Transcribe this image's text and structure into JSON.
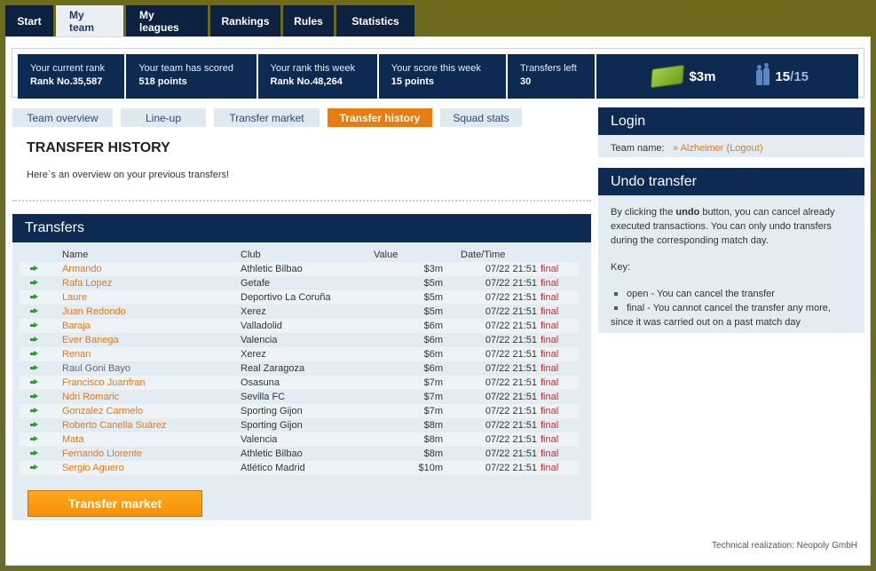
{
  "nav": {
    "tabs": [
      {
        "label": "Start"
      },
      {
        "label": "My team",
        "active": true
      },
      {
        "label": "My leagues"
      },
      {
        "label": "Rankings"
      },
      {
        "label": "Rules"
      },
      {
        "label": "Statistics"
      }
    ]
  },
  "stats": {
    "current_rank_label": "Your current rank",
    "current_rank_value": "Rank No.35,587",
    "scored_label": "Your team has scored",
    "scored_value": "518 points",
    "week_rank_label": "Your rank this week",
    "week_rank_value": "Rank No.48,264",
    "week_score_label": "Your score this week",
    "week_score_value": "15 points",
    "transfers_left_label": "Transfers left",
    "transfers_left_value": "30",
    "budget": "$3m",
    "squad_count": "15",
    "squad_total": "/15",
    "money_icon": "money-stack-icon",
    "squad_icon": "people-icon"
  },
  "subtabs": [
    {
      "label": "Team overview"
    },
    {
      "label": "Line-up"
    },
    {
      "label": "Transfer market"
    },
    {
      "label": "Transfer history",
      "active": true
    },
    {
      "label": "Squad stats"
    }
  ],
  "main": {
    "title": "TRANSFER HISTORY",
    "intro": "Here`s an overview on your previous transfers!"
  },
  "transfers": {
    "heading": "Transfers",
    "columns": {
      "name": "Name",
      "club": "Club",
      "value": "Value",
      "date": "Date/Time"
    },
    "rows": [
      {
        "name": "Armando",
        "club": "Athletic Bilbao",
        "value": "$3m",
        "date": "07/22 21:51",
        "status": "final"
      },
      {
        "name": "Rafa Lopez",
        "club": "Getafe",
        "value": "$5m",
        "date": "07/22 21:51",
        "status": "final"
      },
      {
        "name": "Laure",
        "club": "Deportivo La Coruña",
        "value": "$5m",
        "date": "07/22 21:51",
        "status": "final"
      },
      {
        "name": "Juan Redondo",
        "club": "Xerez",
        "value": "$5m",
        "date": "07/22 21:51",
        "status": "final"
      },
      {
        "name": "Baraja",
        "club": "Valladolid",
        "value": "$6m",
        "date": "07/22 21:51",
        "status": "final"
      },
      {
        "name": "Ever Banega",
        "club": "Valencia",
        "value": "$6m",
        "date": "07/22 21:51",
        "status": "final"
      },
      {
        "name": "Renan",
        "club": "Xerez",
        "value": "$6m",
        "date": "07/22 21:51",
        "status": "final"
      },
      {
        "name": "Raul Goni Bayo",
        "club": "Real Zaragoza",
        "value": "$6m",
        "date": "07/22 21:51",
        "status": "final"
      },
      {
        "name": "Francisco Juanfran",
        "club": "Osasuna",
        "value": "$7m",
        "date": "07/22 21:51",
        "status": "final"
      },
      {
        "name": "Ndri Romaric",
        "club": "Sevilla FC",
        "value": "$7m",
        "date": "07/22 21:51",
        "status": "final"
      },
      {
        "name": "Gonzalez Carmelo",
        "club": "Sporting Gijon",
        "value": "$7m",
        "date": "07/22 21:51",
        "status": "final"
      },
      {
        "name": "Roberto Canella Suárez",
        "club": "Sporting Gijon",
        "value": "$8m",
        "date": "07/22 21:51",
        "status": "final"
      },
      {
        "name": "Mata",
        "club": "Valencia",
        "value": "$8m",
        "date": "07/22 21:51",
        "status": "final"
      },
      {
        "name": "Fernando Llorente",
        "club": "Athletic Bilbao",
        "value": "$8m",
        "date": "07/22 21:51",
        "status": "final"
      },
      {
        "name": "Sergio Aguero",
        "club": "Atlético Madrid",
        "value": "$10m",
        "date": "07/22 21:51",
        "status": "final"
      }
    ],
    "button_label": "Transfer market"
  },
  "login": {
    "heading": "Login",
    "team_label": "Team name:",
    "team_value": "» Alzheimer (Logout)"
  },
  "undo": {
    "heading": "Undo transfer",
    "p1_a": "By clicking the ",
    "p1_b": "undo",
    "p1_c": " button, you can cancel already executed transactions. You can only undo transfers during the corresponding match day.",
    "key": "Key:",
    "item_open": "open - You can cancel the transfer",
    "item_final_a": "final - You cannot cancel the transfer any more,",
    "item_final_b": "since it was carried out on a past match day"
  },
  "footer": "Technical realization: Neopoly GmbH"
}
